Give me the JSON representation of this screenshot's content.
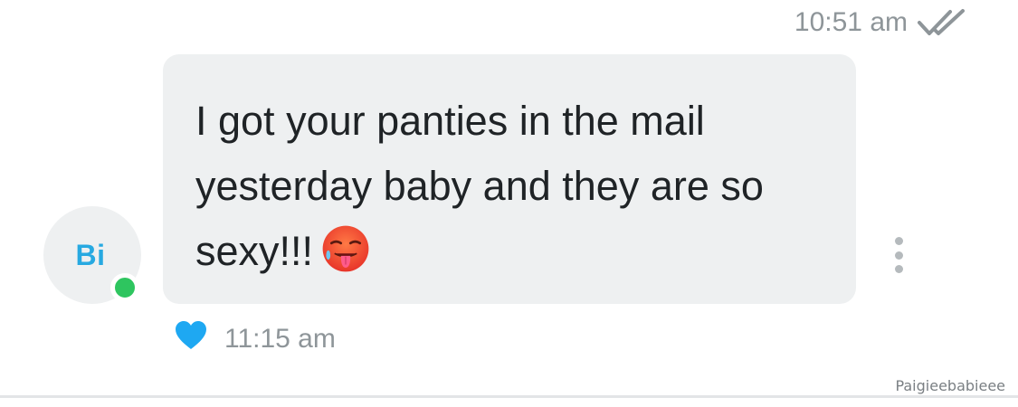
{
  "sent_message": {
    "time": "10:51 am",
    "status_icon": "double-check-icon"
  },
  "incoming_message": {
    "avatar_initials": "Bi",
    "online": true,
    "text": "I got your panties in the mail yesterday baby and they are so sexy!!!",
    "emoji": "hot-face-emoji",
    "reaction_icon": "heart-icon",
    "time": "11:15 am"
  },
  "watermark": "Paigieebabieee",
  "colors": {
    "bubble_bg": "#eef0f1",
    "accent_blue": "#27a9e1",
    "online_green": "#2ec55f",
    "meta_gray": "#8e9599"
  }
}
